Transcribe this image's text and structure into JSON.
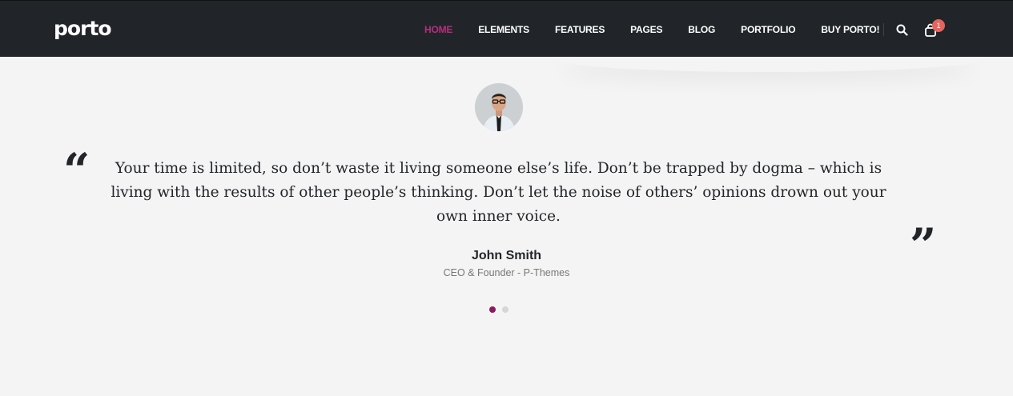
{
  "header": {
    "logo_text": "porto",
    "nav": [
      {
        "label": "HOME",
        "active": true
      },
      {
        "label": "ELEMENTS",
        "active": false
      },
      {
        "label": "FEATURES",
        "active": false
      },
      {
        "label": "PAGES",
        "active": false
      },
      {
        "label": "BLOG",
        "active": false
      },
      {
        "label": "PORTFOLIO",
        "active": false
      },
      {
        "label": "BUY PORTO!",
        "active": false
      }
    ],
    "search_icon": "search-icon",
    "cart_icon": "cart-icon",
    "cart_count": "1"
  },
  "testimonial": {
    "quote": "Your time is limited, so don’t waste it living someone else’s life. Don’t be trapped by dogma – which is living with the results of other people’s thinking. Don’t let the noise of others’ opinions drown out your own inner voice.",
    "author_name": "John Smith",
    "author_role": "CEO & Founder - P-Themes",
    "open_quote_glyph": "“",
    "close_quote_glyph": "”"
  },
  "carousel": {
    "total": 2,
    "active_index": 0
  },
  "colors": {
    "header_bg": "#212529",
    "accent": "#b72e7e",
    "active_dot": "#8c1a5f",
    "badge": "#e4655f",
    "page_bg": "#f4f4f4"
  }
}
